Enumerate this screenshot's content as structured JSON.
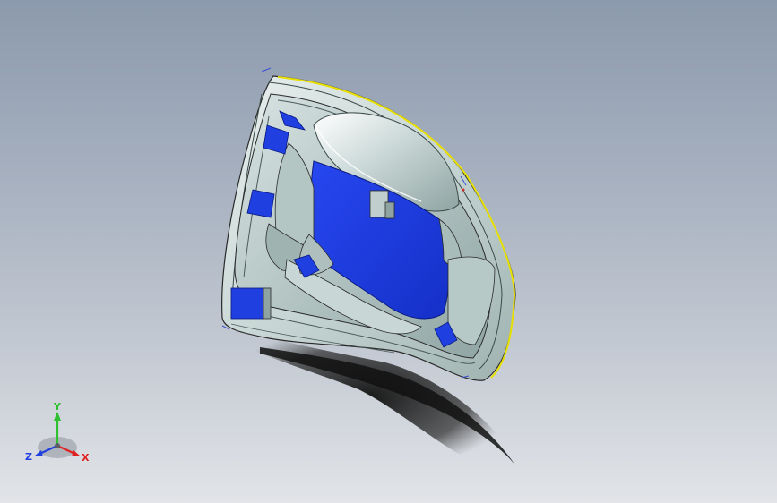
{
  "triad": {
    "x_label": "X",
    "y_label": "Y",
    "z_label": "Z",
    "x_color": "#e02020",
    "y_color": "#2ec02e",
    "z_color": "#2040e0"
  },
  "colors": {
    "background_top": "#8c9aad",
    "background_bottom": "#e2e4e8",
    "part_face_blue": "#1f3fe0",
    "part_face_grey": "#bfcfcf",
    "edge_highlight": "#e8e000",
    "shadow": "#1a1a1a"
  },
  "icons": {
    "triad": "coordinate-triad-icon"
  }
}
